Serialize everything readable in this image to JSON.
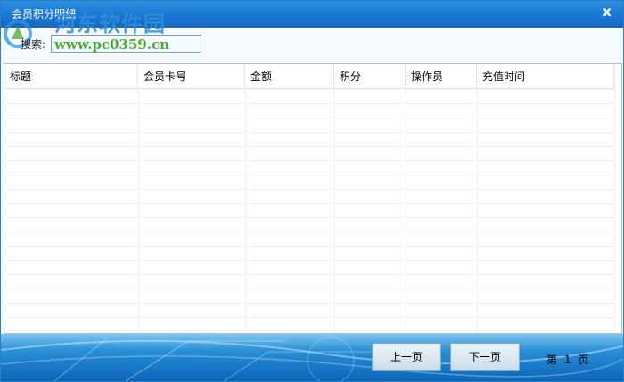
{
  "window": {
    "title": "会员积分明细",
    "close_glyph": "x"
  },
  "watermark": {
    "name": "河东软件园",
    "url": "www.pc0359.cn"
  },
  "search": {
    "label": "搜索:",
    "value": "",
    "placeholder": ""
  },
  "table": {
    "columns": [
      "标题",
      "会员卡号",
      "金额",
      "积分",
      "操作员",
      "充值时间"
    ],
    "rows": []
  },
  "pagination": {
    "prev_label": "上一页",
    "next_label": "下一页",
    "prefix": "第",
    "current_page": "1",
    "suffix": "页"
  },
  "colors": {
    "titlebar": "#1f7ad3",
    "footer": "#0b64b7",
    "watermark_name": "#2f8fdc",
    "watermark_url": "#4cae2f"
  }
}
